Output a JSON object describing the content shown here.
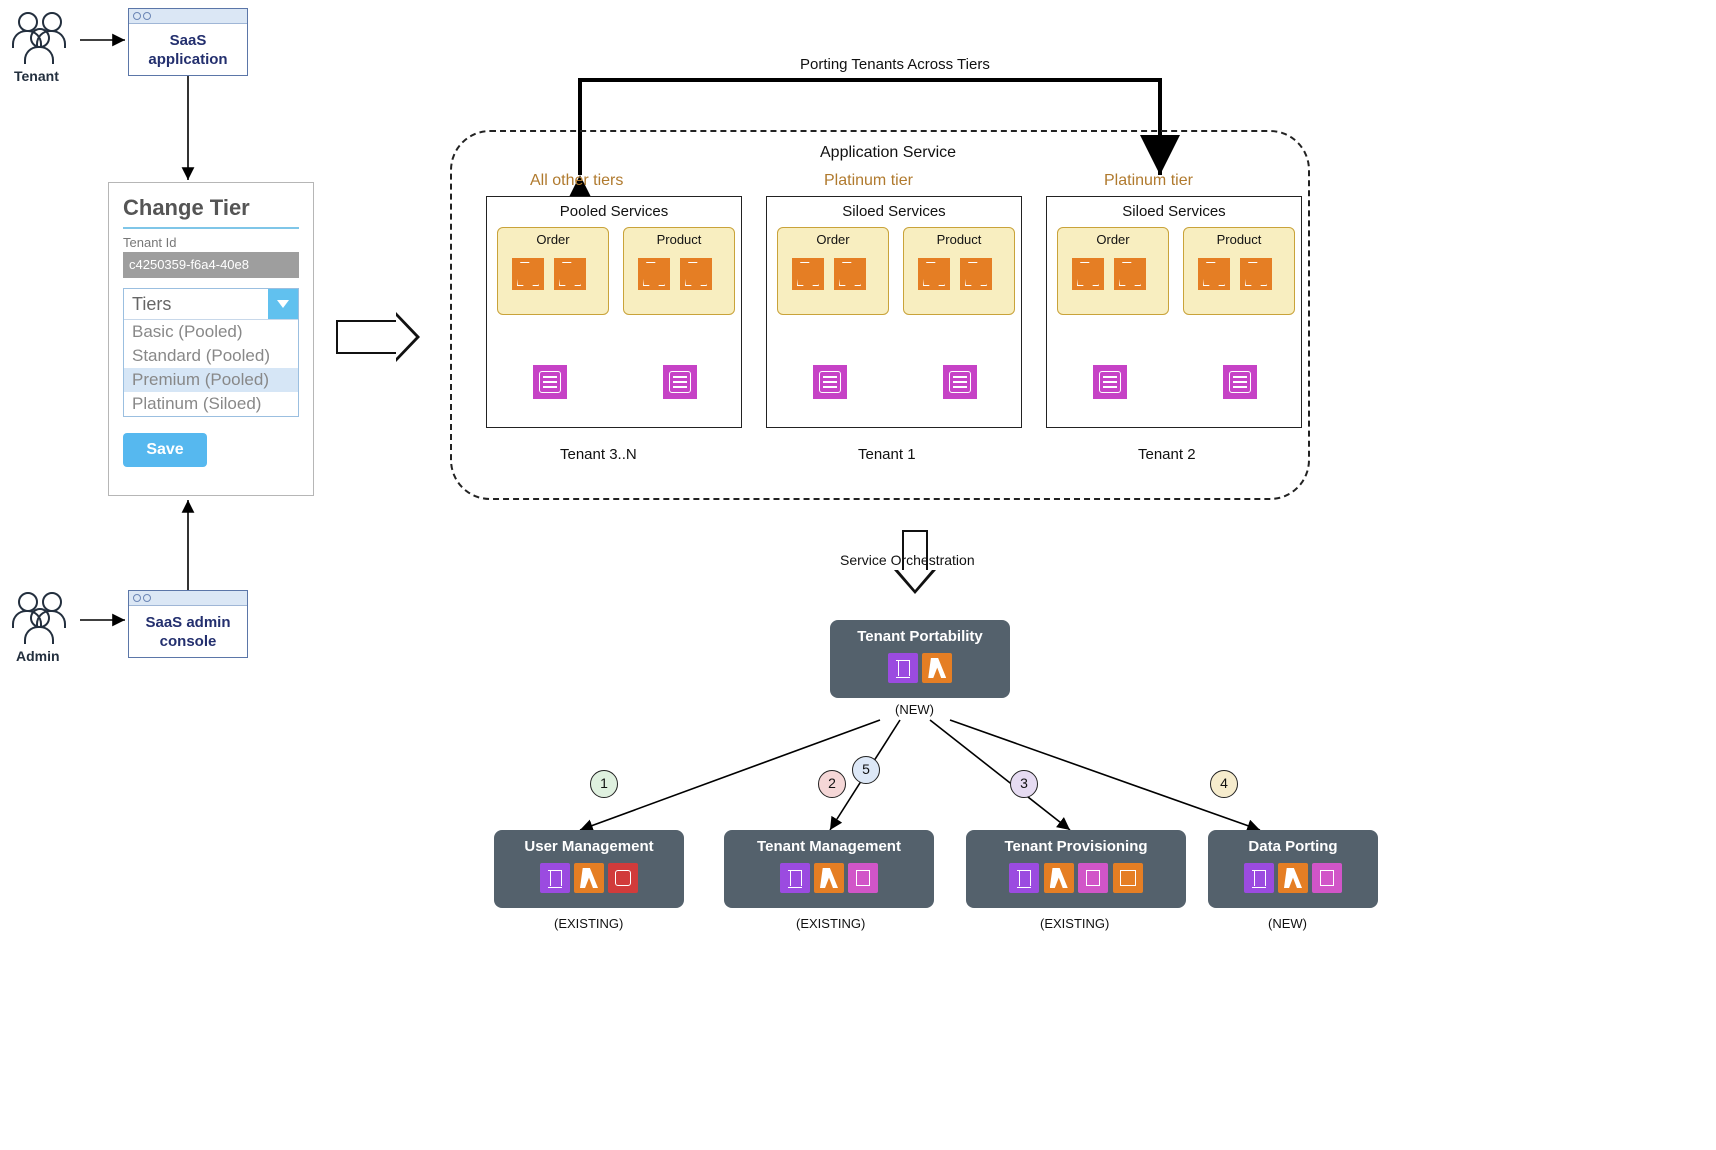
{
  "actors": {
    "tenant": "Tenant",
    "admin": "Admin"
  },
  "browsers": {
    "saas_app": "SaaS\napplication",
    "admin_console": "SaaS admin\nconsole"
  },
  "form": {
    "title": "Change Tier",
    "tenant_id_label": "Tenant Id",
    "tenant_id_value": "c4250359-f6a4-40e8",
    "select_label": "Tiers",
    "options": [
      "Basic (Pooled)",
      "Standard (Pooled)",
      "Premium (Pooled)",
      "Platinum (Siloed)"
    ],
    "selected_index": 2,
    "save": "Save"
  },
  "top_label": "Porting Tenants Across Tiers",
  "app_service": {
    "title": "Application Service",
    "columns": [
      {
        "tier": "All other tiers",
        "group": "Pooled Services",
        "services": [
          "Order",
          "Product"
        ],
        "tenant": "Tenant 3..N"
      },
      {
        "tier": "Platinum tier",
        "group": "Siloed Services",
        "services": [
          "Order",
          "Product"
        ],
        "tenant": "Tenant 1"
      },
      {
        "tier": "Platinum tier",
        "group": "Siloed Services",
        "services": [
          "Order",
          "Product"
        ],
        "tenant": "Tenant 2"
      }
    ]
  },
  "orchestration_label": "Service Orchestration",
  "orchestrator": {
    "name": "Tenant Portability",
    "status": "(NEW)"
  },
  "children": [
    {
      "step": "1",
      "name": "User Management",
      "status": "(EXISTING)"
    },
    {
      "step": "2",
      "extra": "5",
      "name": "Tenant Management",
      "status": "(EXISTING)"
    },
    {
      "step": "3",
      "name": "Tenant Provisioning",
      "status": "(EXISTING)"
    },
    {
      "step": "4",
      "name": "Data Porting",
      "status": "(NEW)"
    }
  ]
}
